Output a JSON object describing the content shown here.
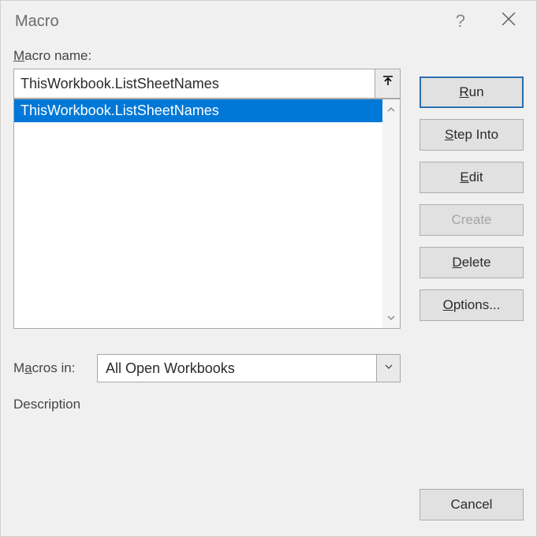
{
  "titlebar": {
    "title": "Macro"
  },
  "labels": {
    "macro_name": "Macro name:",
    "macros_in_prefix": "M",
    "macros_in_accel": "a",
    "macros_in_suffix": "cros in:",
    "description": "Description"
  },
  "macro_input": {
    "value": "ThisWorkbook.ListSheetNames"
  },
  "macro_list": [
    "ThisWorkbook.ListSheetNames"
  ],
  "macros_in_select": {
    "value": "All Open Workbooks"
  },
  "buttons": {
    "run_accel": "R",
    "run_suffix": "un",
    "step_accel": "S",
    "step_suffix": "tep Into",
    "edit_accel": "E",
    "edit_suffix": "dit",
    "create": "Create",
    "delete_accel": "D",
    "delete_suffix": "elete",
    "options_accel": "O",
    "options_suffix": "ptions...",
    "cancel": "Cancel"
  }
}
